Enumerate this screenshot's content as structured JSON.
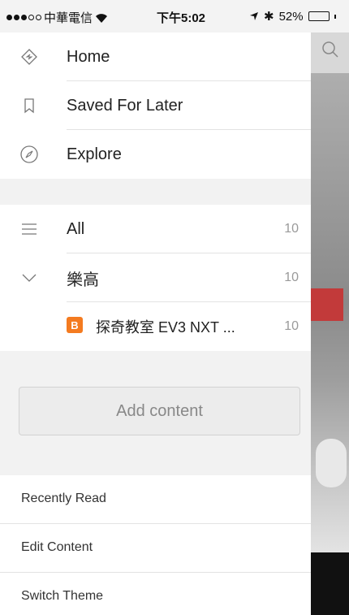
{
  "statusbar": {
    "carrier": "中華電信",
    "time": "下午5:02",
    "battery": "52%",
    "battery_level": 0.52,
    "battery_color": "#4cd964"
  },
  "nav": {
    "home": "Home",
    "saved": "Saved For Later",
    "explore": "Explore"
  },
  "feeds": {
    "all_label": "All",
    "all_count": "10",
    "category_label": "樂高",
    "category_count": "10",
    "source_label": "探奇教室 EV3 NXT ...",
    "source_count": "10",
    "source_icon": "B"
  },
  "actions": {
    "add_content": "Add content"
  },
  "menu": {
    "recently_read": "Recently Read",
    "edit_content": "Edit Content",
    "switch_theme": "Switch Theme"
  },
  "icons": {
    "home": "home-icon",
    "saved": "bookmark-icon",
    "explore": "compass-icon",
    "all": "list-icon",
    "category": "chevron-down-icon",
    "search": "search-icon"
  }
}
